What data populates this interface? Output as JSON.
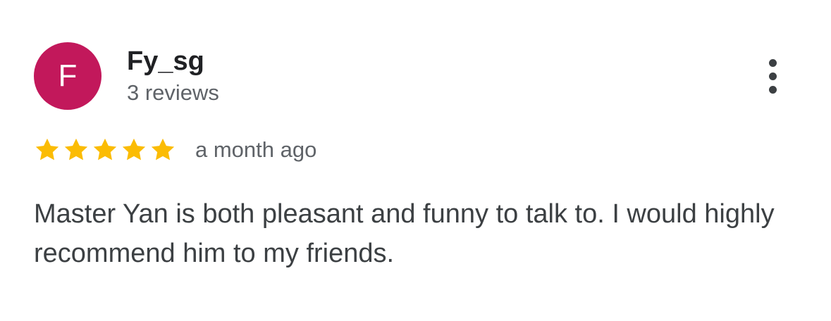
{
  "reviewer": {
    "avatar_letter": "F",
    "avatar_color": "#c2185b",
    "name": "Fy_sg",
    "review_count": "3 reviews"
  },
  "menu": {
    "icon": "more-vert-icon"
  },
  "rating": {
    "stars": 5,
    "max_stars": 5,
    "star_color": "#fbbc04",
    "icon": "star-icon",
    "time_ago": "a month ago"
  },
  "review": {
    "text": "Master Yan is both pleasant and funny to talk to. I would highly recommend him to my friends."
  }
}
